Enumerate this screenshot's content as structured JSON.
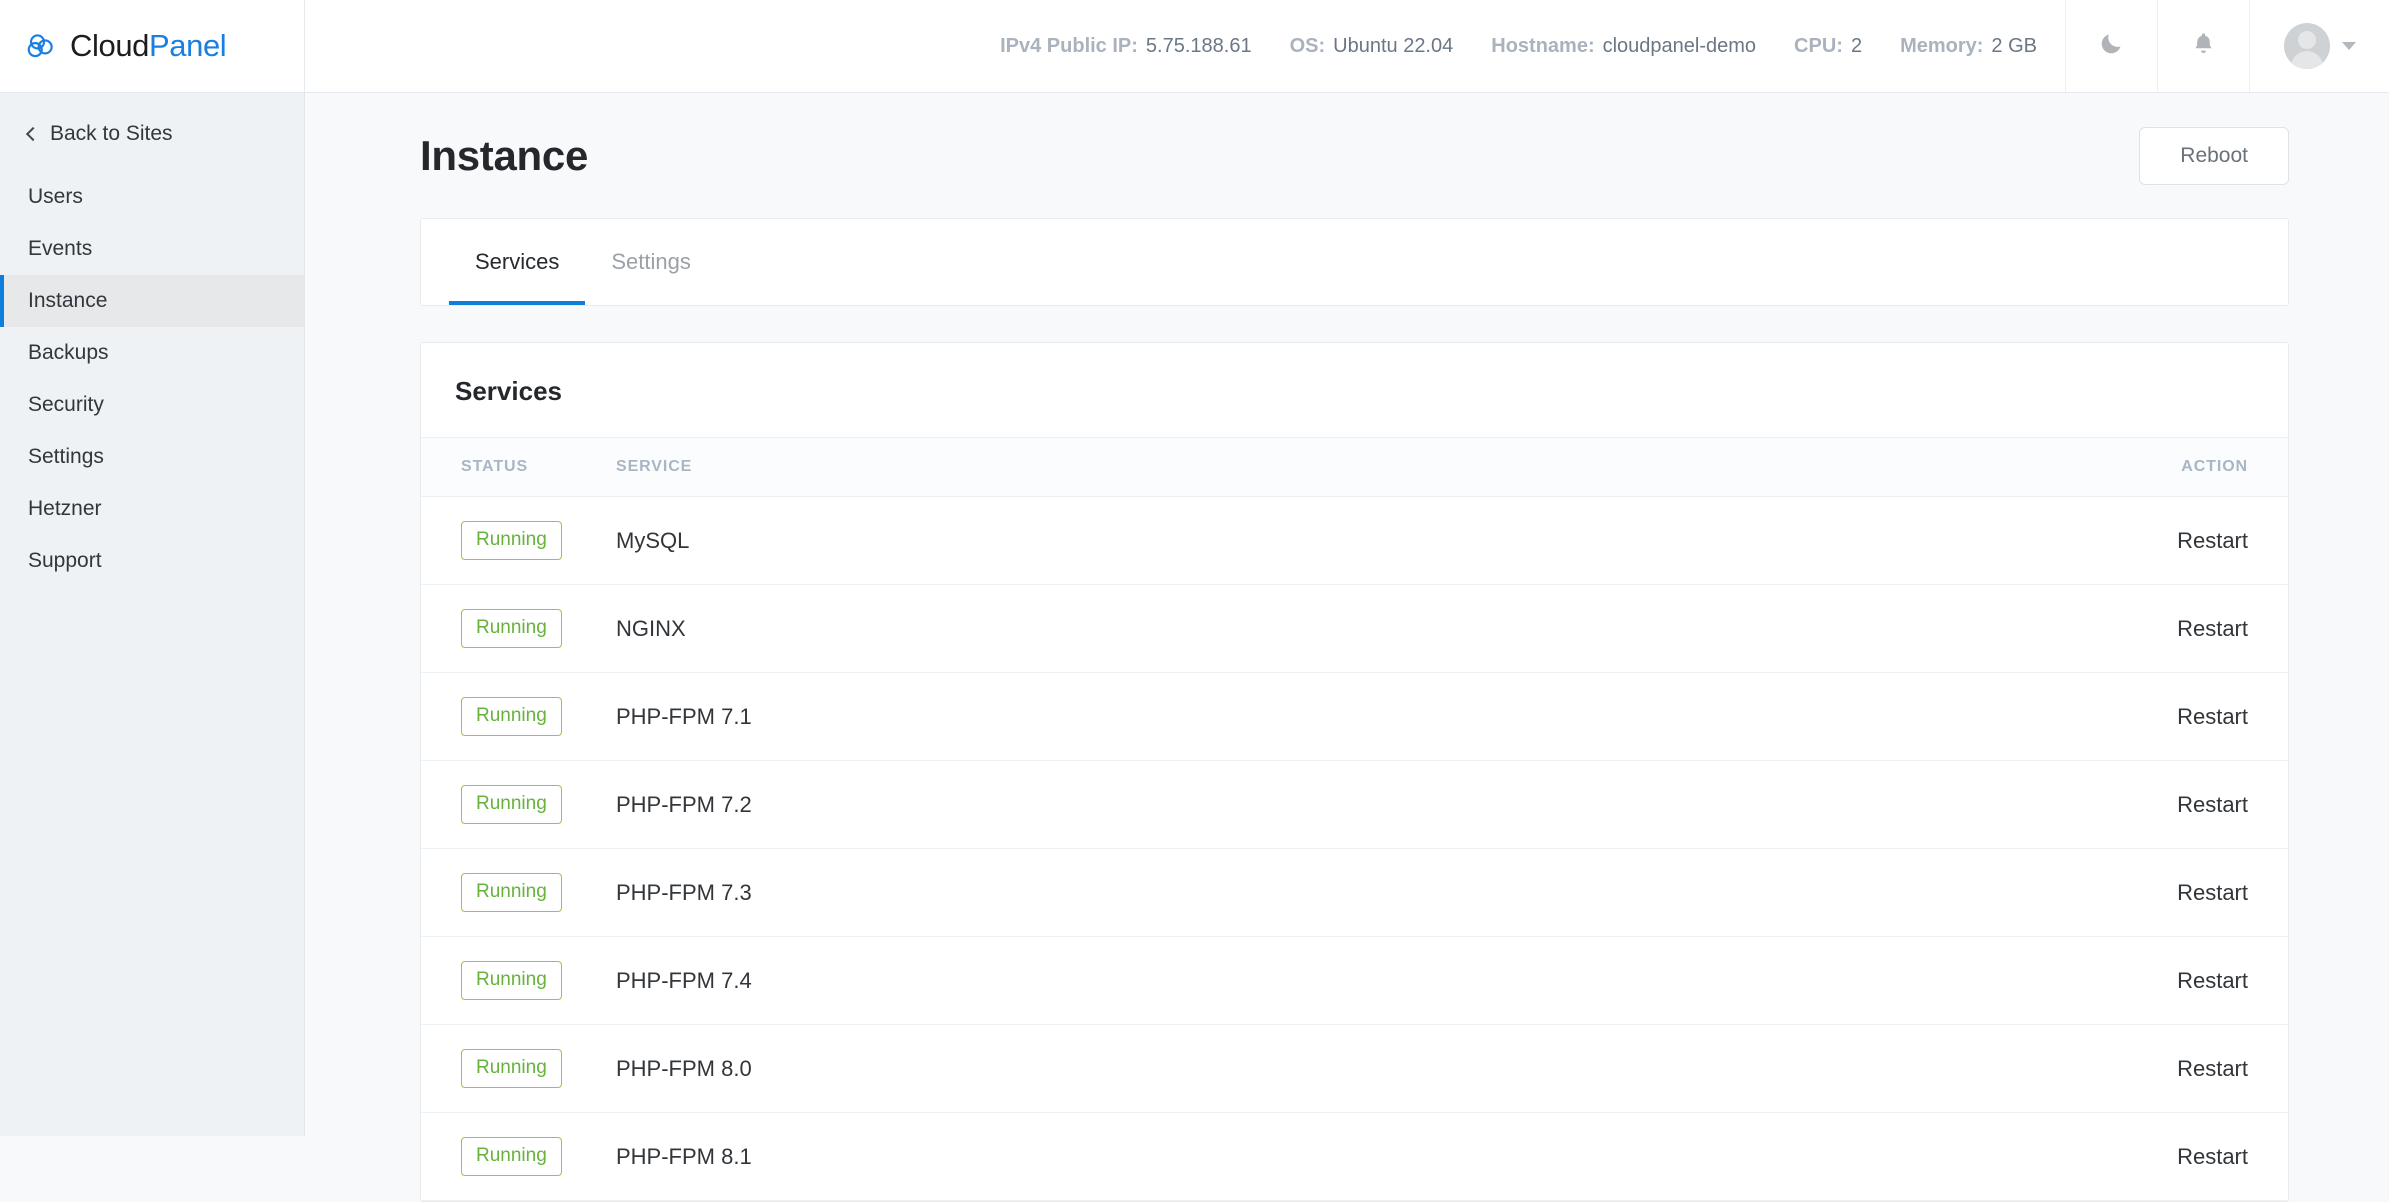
{
  "brand": {
    "name_primary": "Cloud",
    "name_secondary": "Panel",
    "logo_icon": "cloud-icon"
  },
  "topbar": {
    "meta": [
      {
        "label": "IPv4 Public IP:",
        "value": "5.75.188.61"
      },
      {
        "label": "OS:",
        "value": "Ubuntu 22.04"
      },
      {
        "label": "Hostname:",
        "value": "cloudpanel-demo"
      },
      {
        "label": "CPU:",
        "value": "2"
      },
      {
        "label": "Memory:",
        "value": "2 GB"
      }
    ],
    "actions": {
      "dark_mode_icon": "moon-icon",
      "notifications_icon": "bell-icon",
      "user_avatar_icon": "avatar-icon",
      "user_menu_icon": "chevron-down-icon"
    }
  },
  "sidebar": {
    "back_label": "Back to Sites",
    "back_icon": "chevron-left-icon",
    "items": [
      {
        "label": "Users",
        "active": false
      },
      {
        "label": "Events",
        "active": false
      },
      {
        "label": "Instance",
        "active": true
      },
      {
        "label": "Backups",
        "active": false
      },
      {
        "label": "Security",
        "active": false
      },
      {
        "label": "Settings",
        "active": false
      },
      {
        "label": "Hetzner",
        "active": false
      },
      {
        "label": "Support",
        "active": false
      }
    ]
  },
  "main": {
    "page_title": "Instance",
    "reboot_label": "Reboot",
    "tabs": [
      {
        "label": "Services",
        "active": true
      },
      {
        "label": "Settings",
        "active": false
      }
    ],
    "services_card": {
      "title": "Services",
      "columns": [
        "STATUS",
        "SERVICE",
        "ACTION"
      ],
      "rows": [
        {
          "status": "Running",
          "service": "MySQL",
          "action": "Restart"
        },
        {
          "status": "Running",
          "service": "NGINX",
          "action": "Restart"
        },
        {
          "status": "Running",
          "service": "PHP-FPM 7.1",
          "action": "Restart"
        },
        {
          "status": "Running",
          "service": "PHP-FPM 7.2",
          "action": "Restart"
        },
        {
          "status": "Running",
          "service": "PHP-FPM 7.3",
          "action": "Restart"
        },
        {
          "status": "Running",
          "service": "PHP-FPM 7.4",
          "action": "Restart"
        },
        {
          "status": "Running",
          "service": "PHP-FPM 8.0",
          "action": "Restart"
        },
        {
          "status": "Running",
          "service": "PHP-FPM 8.1",
          "action": "Restart"
        }
      ]
    }
  },
  "colors": {
    "accent_blue": "#0f7ddb",
    "brand_blue": "#1b7fe0",
    "status_green": "#66b23b",
    "status_green_border": "#8cc765",
    "sidebar_bg": "#eef2f5",
    "page_bg": "#f8f9fa"
  }
}
